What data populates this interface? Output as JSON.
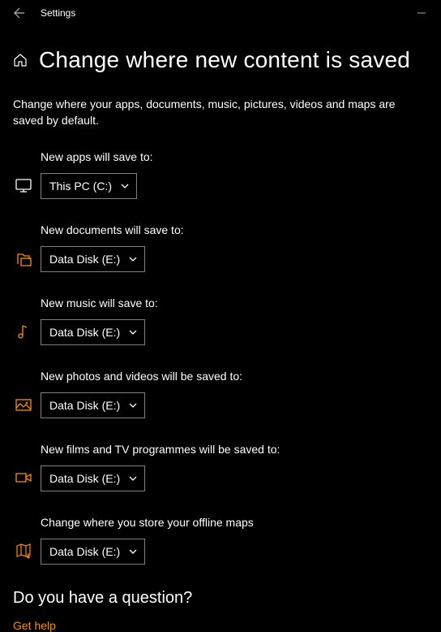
{
  "titlebar": {
    "title": "Settings"
  },
  "page": {
    "title": "Change where new content is saved",
    "description": "Change where your apps, documents, music, pictures, videos and maps are saved by default."
  },
  "colors": {
    "accent": "#ff8c00",
    "text": "#ffffff",
    "border": "#808080",
    "bg": "#000000"
  },
  "settings": {
    "apps": {
      "label": "New apps will save to:",
      "value": "This PC (C:)",
      "accent": false
    },
    "documents": {
      "label": "New documents will save to:",
      "value": "Data Disk (E:)",
      "accent": true
    },
    "music": {
      "label": "New music will save to:",
      "value": "Data Disk (E:)",
      "accent": true
    },
    "photos": {
      "label": "New photos and videos will be saved to:",
      "value": "Data Disk (E:)",
      "accent": true
    },
    "films": {
      "label": "New films and TV programmes will be saved to:",
      "value": "Data Disk (E:)",
      "accent": true
    },
    "maps": {
      "label": "Change where you store your offline maps",
      "value": "Data Disk (E:)",
      "accent": true
    }
  },
  "footer": {
    "question": "Do you have a question?",
    "help": "Get help"
  }
}
